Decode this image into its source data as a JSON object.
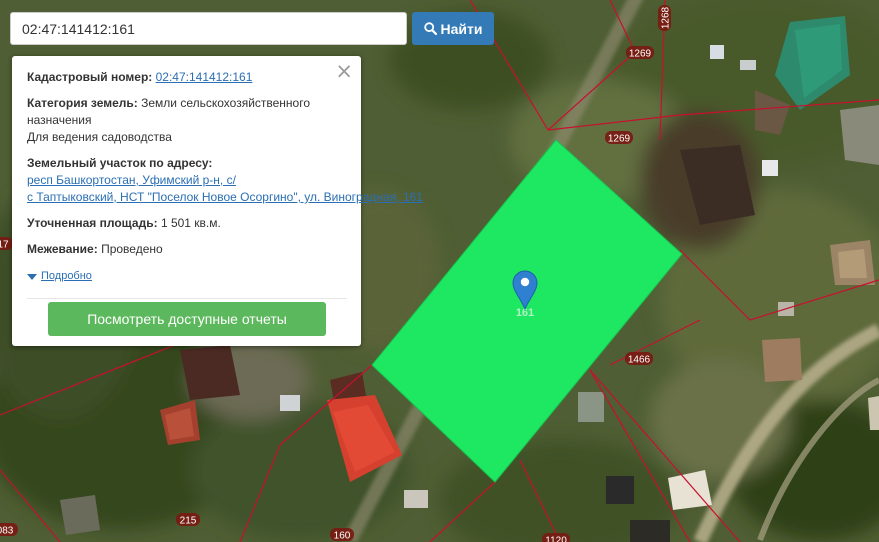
{
  "search": {
    "value": "02:47:141412:161",
    "button_label": "Найти"
  },
  "popup": {
    "cadastral_label": "Кадастровый номер:",
    "cadastral_value": "02:47:141412:161",
    "category_label": "Категория земель:",
    "category_value": "Земли сельскохозяйственного назначения",
    "usage": "Для ведения садоводства",
    "address_label": "Земельный участок по адресу:",
    "address_line1": "респ Башкортостан, Уфимский р-н, с/",
    "address_line2": "с Таптыковский, НСТ \"Поселок Новое Осоргино\", ул. Виноградная, 161",
    "area_label": "Уточненная площадь:",
    "area_value": "1 501 кв.м.",
    "survey_label": "Межевание:",
    "survey_value": "Проведено",
    "more_link": "Подробно",
    "report_button": "Посмотреть доступные отчеты"
  },
  "map": {
    "highlight_color": "#1ee861",
    "parcel_line_color": "#c8102e",
    "marker_color": "#2f80d0",
    "parcel_labels": {
      "l1268": "1268",
      "l1269a": "1269",
      "l1269b": "1269",
      "l1466": "1466",
      "l215": "215",
      "l160": "160",
      "l1120": "1120",
      "l083": "083",
      "l17": "17",
      "l161": "161"
    }
  }
}
